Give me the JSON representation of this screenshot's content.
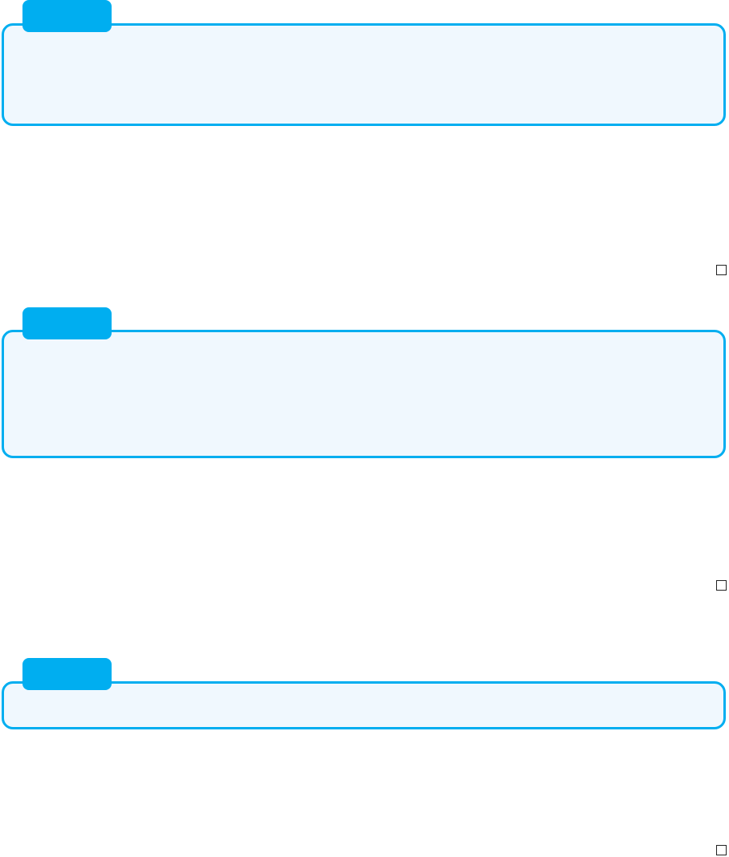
{
  "colors": {
    "accent": "#00aef0",
    "box_fill": "#f0f8fe",
    "checkbox_border": "#222222"
  },
  "sections": [
    {
      "tab_label": "",
      "body_text": "",
      "checkbox_icon": "empty-checkbox-icon"
    },
    {
      "tab_label": "",
      "body_text": "",
      "checkbox_icon": "empty-checkbox-icon"
    },
    {
      "tab_label": "",
      "body_text": "",
      "checkbox_icon": "empty-checkbox-icon"
    }
  ]
}
